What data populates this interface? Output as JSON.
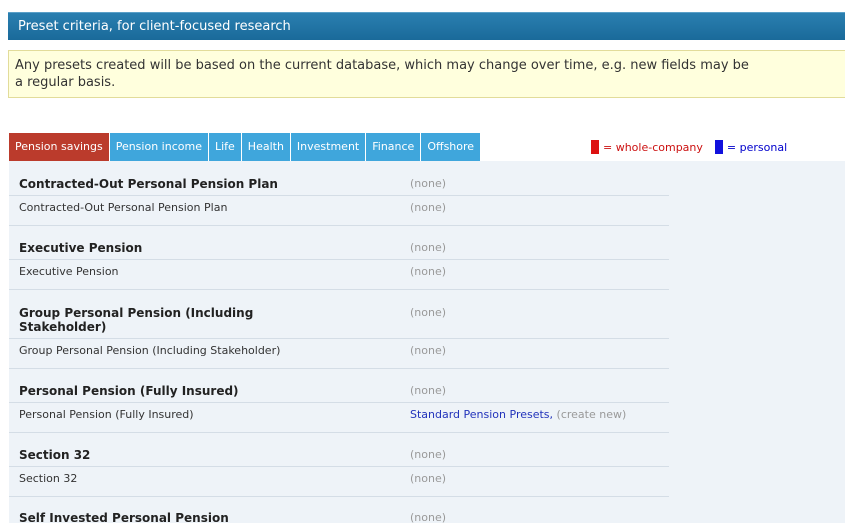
{
  "title": "Preset criteria, for client-focused research",
  "notice": "Any presets created will be based on the current database, which may change over time, e.g. new fields may be a regular basis.",
  "notice_line1": "Any presets created will be based on the current database, which may change over time, e.g. new fields may be",
  "notice_line2": "a regular basis.",
  "tabs": [
    "Pension savings",
    "Pension income",
    "Life",
    "Health",
    "Investment",
    "Finance",
    "Offshore"
  ],
  "active_tab": "Pension savings",
  "legend": {
    "company_label": "= whole-company",
    "personal_label": "= personal",
    "company_color": "#dd1111",
    "personal_color": "#1111dd"
  },
  "rows": [
    {
      "name": "Contracted-Out Personal Pension Plan",
      "value": "(none)"
    },
    {
      "name": "Contracted-Out Personal Pension Plan",
      "value": "(none)"
    },
    {
      "name": "Executive Pension",
      "value": "(none)"
    },
    {
      "name": "Executive Pension",
      "value": "(none)"
    },
    {
      "name": "Group Personal Pension (Including Stakeholder)",
      "value": "(none)"
    },
    {
      "name": "Group Personal Pension (Including Stakeholder)",
      "value": "(none)"
    },
    {
      "name": "Personal Pension (Fully Insured)",
      "value": "(none)"
    },
    {
      "name": "Personal Pension (Fully Insured)",
      "link": "Standard Pension Presets,",
      "extra": "(create new)"
    },
    {
      "name": "Section 32",
      "value": "(none)"
    },
    {
      "name": "Section 32",
      "value": "(none)"
    },
    {
      "name": "Self Invested Personal Pension",
      "value": "(none)"
    }
  ]
}
